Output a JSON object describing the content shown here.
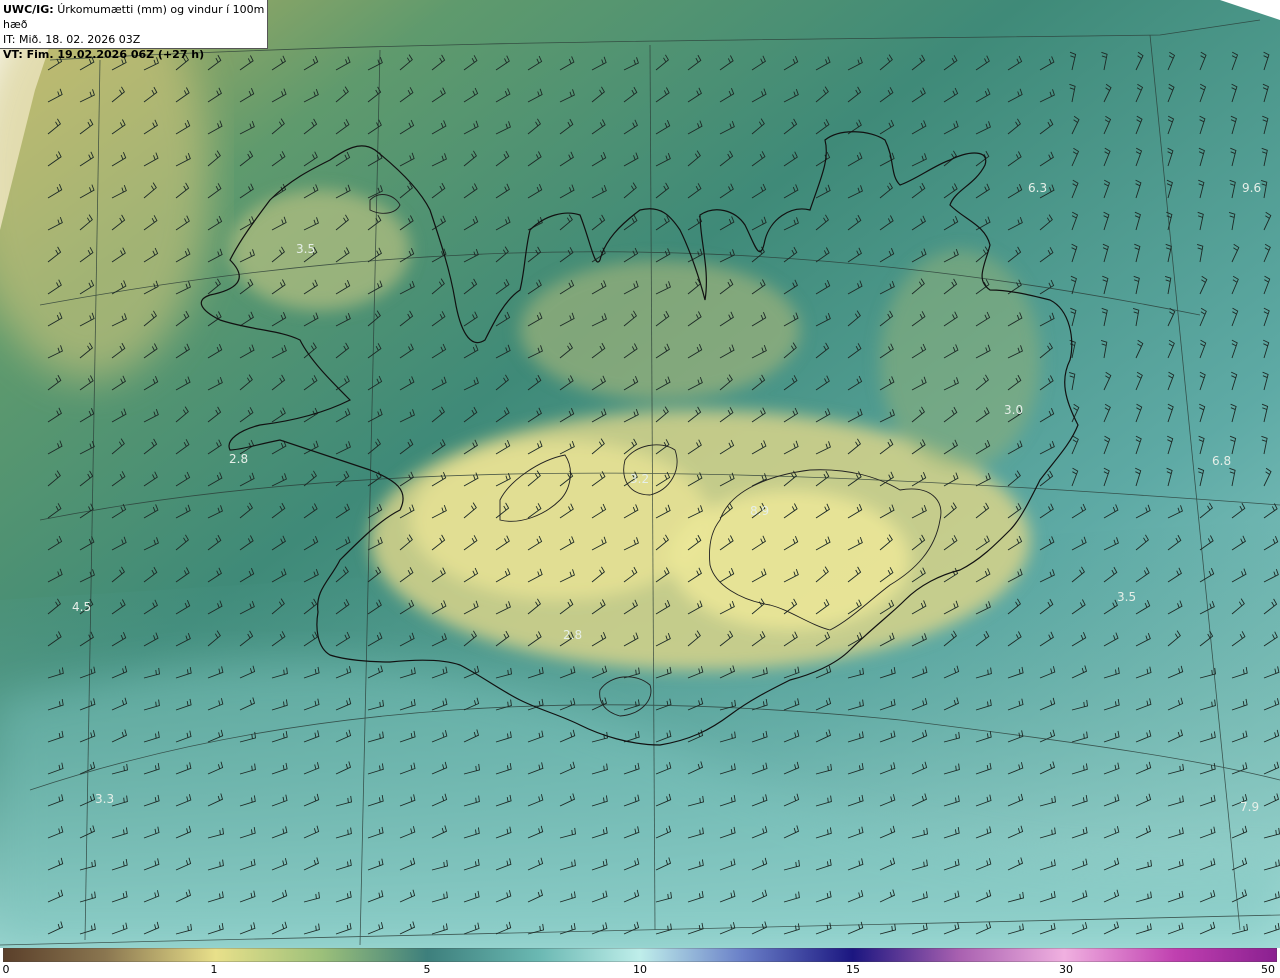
{
  "header": {
    "product_code": "UWC/IG:",
    "product_desc": "Úrkomumætti (mm) og vindur í 100m hæð",
    "init_time": "IT: Mið. 18. 02. 2026 03Z",
    "valid_time": "VT: Fim. 19.02.2026 06Z (+27 h)"
  },
  "colorbar": {
    "ticks": [
      "0",
      "1",
      "5",
      "10",
      "15",
      "30",
      "50"
    ],
    "colors": [
      "#5a3f2a",
      "#9c8a55",
      "#e8e08a",
      "#6aa37a",
      "#3d7f7c",
      "#a8e6e0",
      "#1b1680",
      "#e8a8e0",
      "#9c2a9c"
    ]
  },
  "map_labels": [
    "3.5",
    "2.8",
    "4.5",
    "3.3",
    "6.3",
    "9.6",
    "3.0",
    "6.8",
    "3.5",
    "7.9",
    "8.9",
    "3.2",
    "2.8"
  ],
  "colors": {
    "ocean_teal": "#2f7d72",
    "coastline": "#111111",
    "land_yellow": "#d6d58a",
    "light_cyan": "#a6dad6"
  }
}
